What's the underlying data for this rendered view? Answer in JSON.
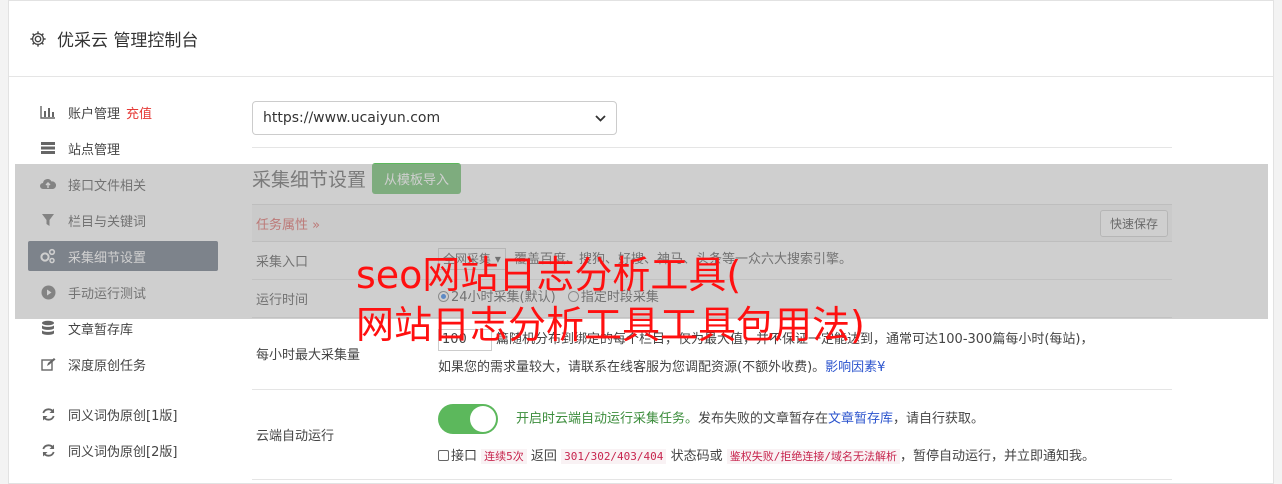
{
  "header": {
    "title": "优采云 管理控制台"
  },
  "sidebar": {
    "items": [
      {
        "label": "账户管理",
        "extra": "充值",
        "icon": "bar-chart-icon"
      },
      {
        "label": "站点管理",
        "icon": "server-icon"
      },
      {
        "label": "接口文件相关",
        "icon": "cloud-upload-icon"
      },
      {
        "label": "栏目与关键词",
        "icon": "filter-icon"
      },
      {
        "label": "采集细节设置",
        "icon": "gears-icon",
        "active": true
      },
      {
        "label": "手动运行测试",
        "icon": "play-icon"
      },
      {
        "label": "文章暂存库",
        "icon": "database-icon"
      },
      {
        "label": "深度原创任务",
        "icon": "edit-icon"
      }
    ],
    "items2": [
      {
        "label": "同义词伪原创[1版]",
        "icon": "refresh-icon"
      },
      {
        "label": "同义词伪原创[2版]",
        "icon": "refresh-icon"
      }
    ]
  },
  "main": {
    "site_select": "https://www.ucaiyun.com",
    "section_title": "采集细节设置",
    "import_button": "从模板导入",
    "task_attr": "任务属性",
    "quick_save": "快速保存",
    "rows": {
      "entry_label": "采集入口",
      "entry_value": "全网采集",
      "entry_desc": "覆盖百度、搜狗、好搜、神马、头条等一众六大搜索引擎。",
      "time_label": "运行时间",
      "time_opt1": "24小时采集(默认)",
      "time_opt2": "指定时段采集",
      "max_label": "每小时最大采集量",
      "max_value": "100",
      "max_unit": "篇",
      "max_desc1": "随机分布到绑定的每个栏目，仅为最大值，并不保证一定能达到，通常可达100-300篇每小时(每站)，",
      "max_desc2": "如果您的需求量较大，请联系在线客服为您调配资源(不额外收费)。",
      "max_link": "影响因素",
      "cloud_label": "云端自动运行",
      "cloud_desc_a": "开启时云端自动运行采集任务。",
      "cloud_desc_b": "发布失败的文章暂存在",
      "cloud_link": "文章暂存库",
      "cloud_desc_c": "，请自行获取。",
      "api_chk": "接口",
      "code1": "连续5次",
      "api_t1": "返回",
      "code2": "301/302/403/404",
      "api_t2": "状态码或",
      "code3": "鉴权失败/拒绝连接/域名无法解析",
      "api_t3": "，暂停自动运行，并立即通知我。"
    }
  },
  "headline": {
    "line1": "seo网站日志分析工具(",
    "line2": "网站日志分析工具工具包用法)"
  }
}
